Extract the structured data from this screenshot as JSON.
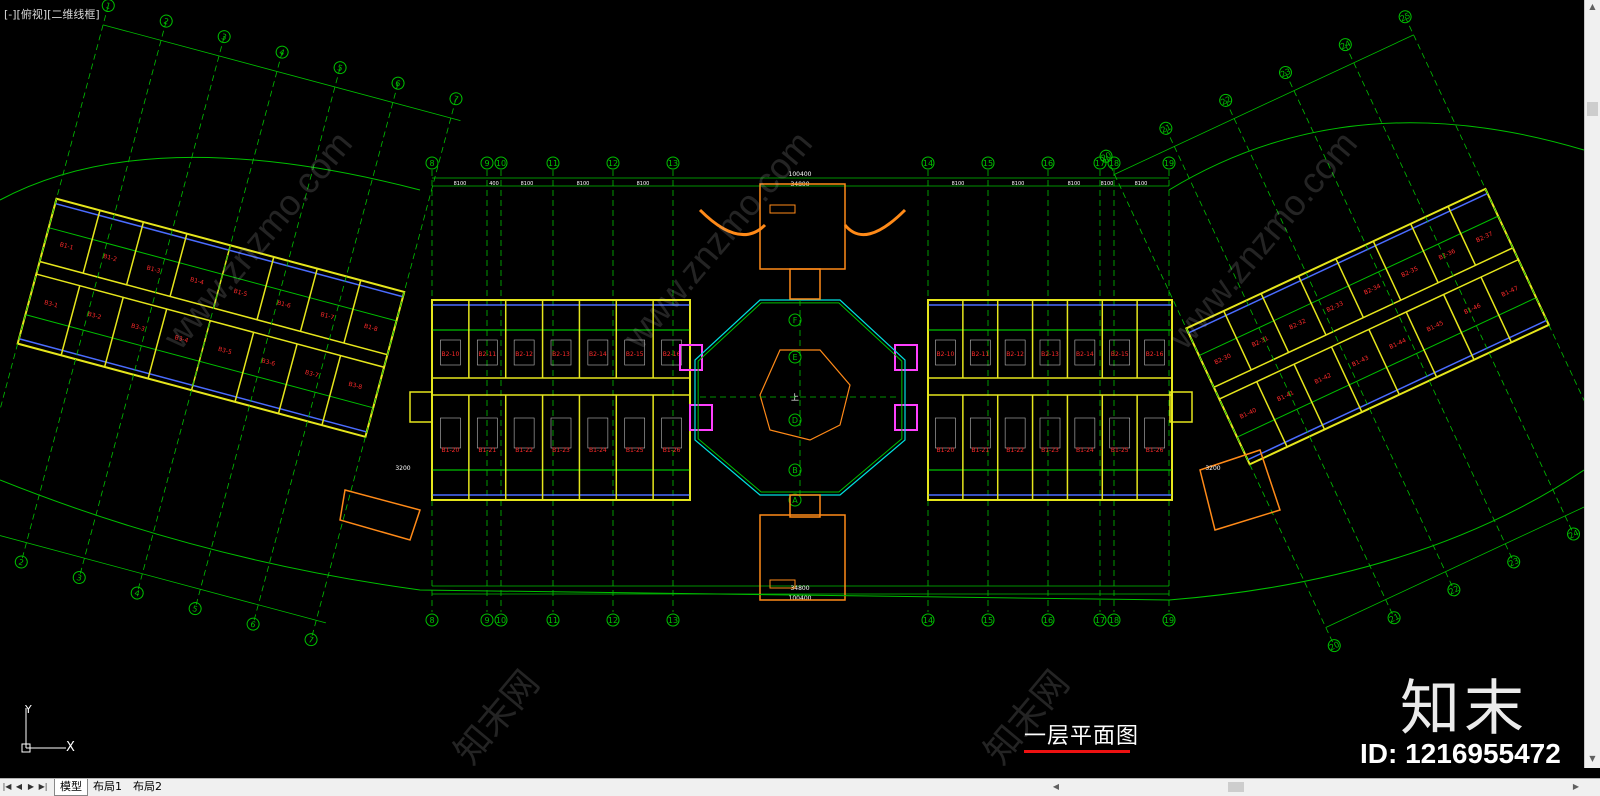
{
  "viewport": {
    "label": "[-][俯视][二维线框]",
    "background": "#000000"
  },
  "drawing": {
    "title": "一层平面图",
    "title_color": "#ffffff",
    "underline_color": "#e11111",
    "dim_total": "100400",
    "dim_center": "34800",
    "dim_bays": [
      "8100",
      "400",
      "8100",
      "8100",
      "8100",
      "8100"
    ],
    "dim_label_small": "3200",
    "center_label": "上",
    "axes_top": [
      "8",
      "9",
      "10",
      "11",
      "12",
      "13",
      "14",
      "15",
      "16",
      "17",
      "18",
      "19"
    ],
    "axes_center": [
      "F",
      "E",
      "D",
      "B",
      "A"
    ],
    "axes_left": [
      "1",
      "2",
      "3",
      "4",
      "5",
      "6",
      "7"
    ],
    "axes_right": [
      "20",
      "21",
      "22",
      "23",
      "24",
      "25"
    ]
  },
  "watermarks": {
    "site": "www.znzmo.com",
    "cn": "知末网",
    "brand": "知末",
    "id": "ID: 1216955472"
  },
  "ucs": {
    "y": "Y",
    "x": "X"
  },
  "layout_tabs": [
    {
      "label": "模型",
      "active": true
    },
    {
      "label": "布局1",
      "active": false
    },
    {
      "label": "布局2",
      "active": false
    }
  ],
  "colors": {
    "grid": "#00c000",
    "wall": "#e6e61c",
    "room_label": "#ff2a2a",
    "blue": "#4a6cff",
    "magenta": "#ff40ff",
    "orange": "#ff8a18",
    "cyan": "#00e0e0"
  }
}
